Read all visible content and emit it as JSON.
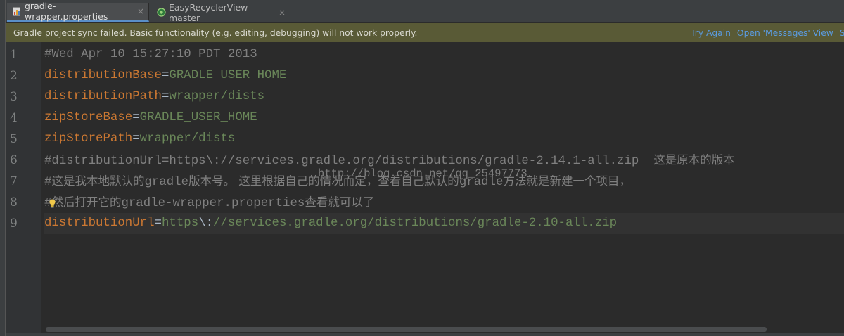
{
  "tabs": [
    {
      "label": "gradle-wrapper.properties",
      "icon": "gradle-file-icon",
      "active": true
    },
    {
      "label": "EasyRecyclerView-master",
      "icon": "android-module-icon",
      "active": false
    }
  ],
  "tab_close_glyph": "×",
  "notification": {
    "message": "Gradle project sync failed. Basic functionality (e.g. editing, debugging) will not work properly.",
    "links": [
      "Try Again",
      "Open 'Messages' View",
      "Sh"
    ]
  },
  "editor": {
    "line_numbers": [
      "1",
      "2",
      "3",
      "4",
      "5",
      "6",
      "7",
      "8",
      "9"
    ],
    "lines": {
      "l1": {
        "comment": "#Wed Apr 10 15:27:10 PDT 2013"
      },
      "l2": {
        "key": "distributionBase",
        "eq": "=",
        "value": "GRADLE_USER_HOME"
      },
      "l3": {
        "key": "distributionPath",
        "eq": "=",
        "value": "wrapper/dists"
      },
      "l4": {
        "key": "zipStoreBase",
        "eq": "=",
        "value": "GRADLE_USER_HOME"
      },
      "l5": {
        "key": "zipStorePath",
        "eq": "=",
        "value": "wrapper/dists"
      },
      "l6": {
        "comment_a": "#distributionUrl=https\\://services.gradle.org/distributions/gradle-2.14.1-all.zip  ",
        "comment_b": "这是原本的版本"
      },
      "l7": {
        "comment_a": "#",
        "comment_b": "这是我本地默认的",
        "comment_c": "gradle",
        "comment_d": "版本号。 这里根据自己的情况而定，查看自己默认的",
        "comment_e": "gradle",
        "comment_f": "方法就是新建一个项目，"
      },
      "l8": {
        "comment_a": "#",
        "comment_b": "然后打开它的",
        "comment_c": "gradle-wrapper.properties",
        "comment_d": "查看就可以了"
      },
      "l9": {
        "key": "distributionUrl",
        "eq": "=",
        "value_a": "https",
        "value_b": "\\:",
        "value_c": "//services.gradle.org/distributions/gradle-2.10-all.zip"
      }
    },
    "watermark": "http://blog.csdn.net/qq_25497773"
  },
  "colors": {
    "background": "#2b2b2b",
    "key": "#cc7832",
    "value": "#6a8759",
    "comment": "#808080",
    "notification_bg": "#595a36",
    "link": "#5a9be0"
  }
}
